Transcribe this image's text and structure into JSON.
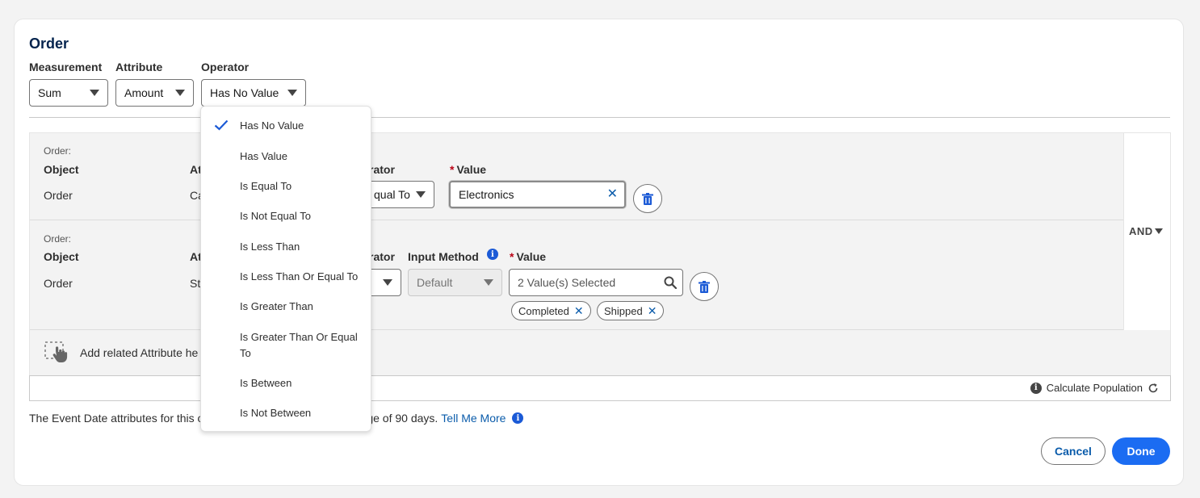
{
  "title": "Order",
  "top_fields": {
    "measurement_label": "Measurement",
    "measurement_value": "Sum",
    "attribute_label": "Attribute",
    "attribute_value": "Amount",
    "operator_label": "Operator",
    "operator_value": "Has No Value"
  },
  "rule1": {
    "path": "Order:",
    "object_label": "Object",
    "object_value": "Order",
    "attribute_label_partial": "At",
    "attribute_value_partial": "Ca",
    "operator_label_partial": "rator",
    "operator_value_partial": "qual To",
    "value_label": "Value",
    "value": "Electronics"
  },
  "rule2": {
    "path": "Order:",
    "object_label": "Object",
    "object_value": "Order",
    "attribute_label_partial": "At",
    "attribute_value_partial": "St",
    "operator_label_partial": "rator",
    "input_method_label": "Input Method",
    "input_method_value": "Default",
    "value_label": "Value",
    "value_placeholder": "2 Value(s) Selected",
    "pills": [
      "Completed",
      "Shipped"
    ]
  },
  "logic": "AND",
  "add_related_partial": "Add related Attribute he",
  "calculate_label": "Calculate Population",
  "note_start": "The Event Date attributes for this o",
  "note_end": "ge of 90 days.",
  "tell_me_more": "Tell Me More",
  "buttons": {
    "cancel": "Cancel",
    "done": "Done"
  },
  "operator_menu": {
    "selected": "Has No Value",
    "options": [
      "Has No Value",
      "Has Value",
      "Is Equal To",
      "Is Not Equal To",
      "Is Less Than",
      "Is Less Than Or Equal To",
      "Is Greater Than",
      "Is Greater Than Or Equal To",
      "Is Between",
      "Is Not Between"
    ]
  },
  "colors": {
    "brand_blue": "#1b6cf2",
    "link_blue": "#0b5cab",
    "title_navy": "#03234d",
    "required_red": "#ba0517"
  }
}
